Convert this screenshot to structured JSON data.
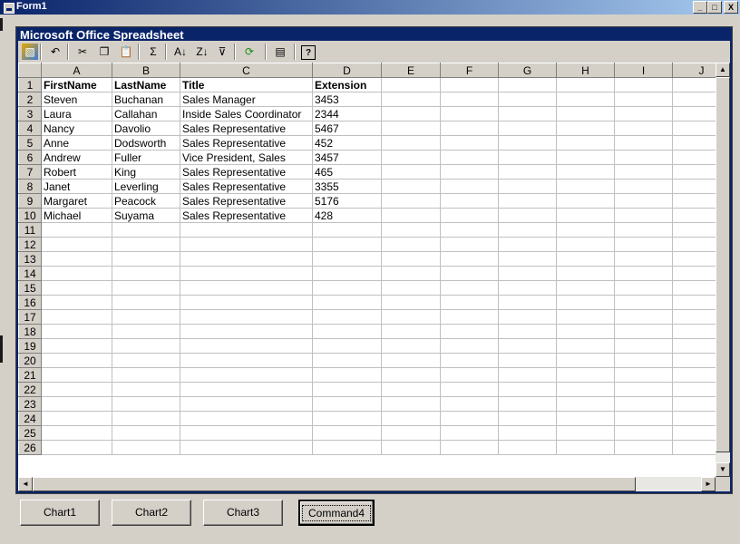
{
  "window": {
    "title": "Form1",
    "minimize": "_",
    "maximize": "□",
    "close": "X"
  },
  "spreadsheet": {
    "title": "Microsoft Office Spreadsheet",
    "toolbar": [
      {
        "name": "office-logo-icon",
        "glyph": "▧"
      },
      {
        "name": "undo-icon",
        "glyph": "↶"
      },
      {
        "name": "cut-icon",
        "glyph": "✂"
      },
      {
        "name": "copy-icon",
        "glyph": "❐"
      },
      {
        "name": "paste-icon",
        "glyph": "📋"
      },
      {
        "name": "autosum-icon",
        "glyph": "Σ"
      },
      {
        "name": "sort-ascending-icon",
        "glyph": "A↓"
      },
      {
        "name": "sort-descending-icon",
        "glyph": "Z↓"
      },
      {
        "name": "autofilter-icon",
        "glyph": "⊽"
      },
      {
        "name": "refresh-icon",
        "glyph": "⟳"
      },
      {
        "name": "export-icon",
        "glyph": "▤"
      },
      {
        "name": "help-icon",
        "glyph": "?"
      }
    ],
    "columns": [
      "A",
      "B",
      "C",
      "D",
      "E",
      "F",
      "G",
      "H",
      "I",
      "J"
    ],
    "rows": [
      [
        "FirstName",
        "LastName",
        "Title",
        "Extension"
      ],
      [
        "Steven",
        "Buchanan",
        "Sales Manager",
        "3453"
      ],
      [
        "Laura",
        "Callahan",
        "Inside Sales Coordinator",
        "2344"
      ],
      [
        "Nancy",
        "Davolio",
        "Sales Representative",
        "5467"
      ],
      [
        "Anne",
        "Dodsworth",
        "Sales Representative",
        "452"
      ],
      [
        "Andrew",
        "Fuller",
        "Vice President, Sales",
        "3457"
      ],
      [
        "Robert",
        "King",
        "Sales Representative",
        "465"
      ],
      [
        "Janet",
        "Leverling",
        "Sales Representative",
        "3355"
      ],
      [
        "Margaret",
        "Peacock",
        "Sales Representative",
        "5176"
      ],
      [
        "Michael",
        "Suyama",
        "Sales Representative",
        "428"
      ]
    ],
    "row_numbers": [
      "1",
      "2",
      "3",
      "4",
      "5",
      "6",
      "7",
      "8",
      "9",
      "10",
      "11",
      "12",
      "13",
      "14",
      "15",
      "16",
      "17",
      "18",
      "19",
      "20",
      "21",
      "22",
      "23",
      "24",
      "25",
      "26"
    ],
    "scroll_up": "▲",
    "scroll_down": "▼",
    "scroll_left": "◄",
    "scroll_right": "►"
  },
  "buttons": [
    {
      "label": "Chart1"
    },
    {
      "label": "Chart2"
    },
    {
      "label": "Chart3"
    },
    {
      "label": "Command4"
    }
  ]
}
